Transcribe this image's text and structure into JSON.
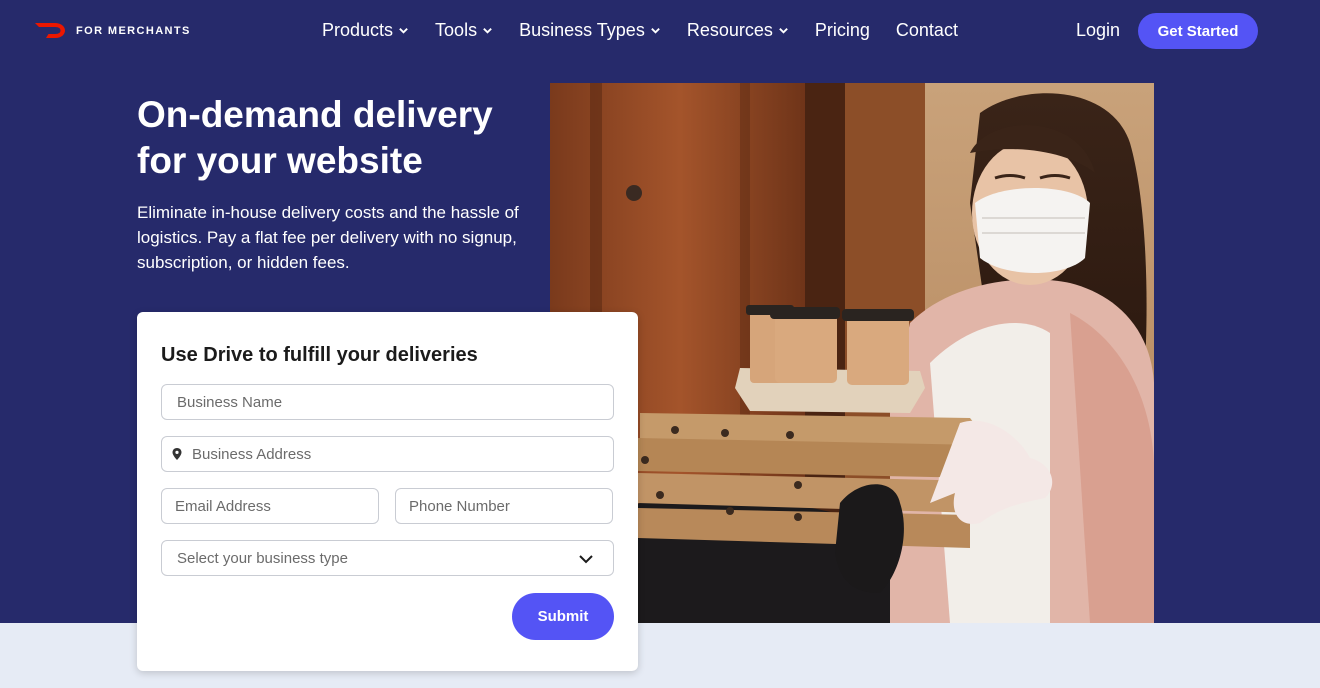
{
  "nav": {
    "logo_text": "FOR MERCHANTS",
    "logo_icon": "doordash-dash-icon",
    "menu": [
      {
        "label": "Products",
        "has_dropdown": true
      },
      {
        "label": "Tools",
        "has_dropdown": true
      },
      {
        "label": "Business Types",
        "has_dropdown": true
      },
      {
        "label": "Resources",
        "has_dropdown": true
      },
      {
        "label": "Pricing",
        "has_dropdown": false
      },
      {
        "label": "Contact",
        "has_dropdown": false
      }
    ],
    "login_label": "Login",
    "cta_label": "Get Started"
  },
  "hero": {
    "headline_line1": "On-demand delivery",
    "headline_line2": "for your website",
    "subtext": "Eliminate in-house delivery costs and the hassle of logistics. Pay a flat fee per delivery with no signup, subscription, or hidden fees."
  },
  "form": {
    "title": "Use Drive to fulfill your deliveries",
    "business_name_placeholder": "Business Name",
    "business_address_placeholder": "Business Address",
    "email_placeholder": "Email Address",
    "phone_placeholder": "Phone Number",
    "business_type_placeholder": "Select your business type",
    "submit_label": "Submit"
  },
  "colors": {
    "hero_bg": "#262a6b",
    "accent": "#5454f5",
    "logo_red": "#eb1700",
    "bottom_band": "#e6ebf5"
  }
}
